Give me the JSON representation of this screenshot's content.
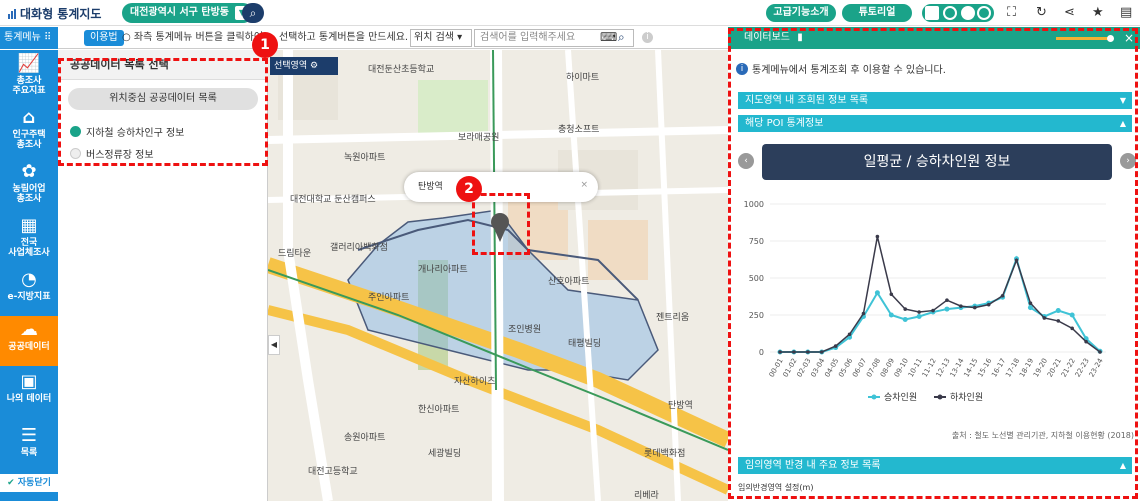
{
  "topbar": {
    "title": "대화형 통계지도",
    "region": "대전광역시 서구 탄방동",
    "advanced_label": "고급기능소개",
    "tutorial_label": "튜토리얼"
  },
  "controls": {
    "menu_label": "통계메뉴",
    "usage_label": "이용법",
    "guide_text": "좌측 통계메뉴 버튼을 클릭하여 ... 선택하고 통계버튼을 만드세요.",
    "location_select": "위치 검색",
    "address_placeholder": "검색어를 입력해주세요"
  },
  "sidebar": {
    "items": [
      {
        "label1": "총조사",
        "label2": "주요지표",
        "icon": "chart-icon"
      },
      {
        "label1": "인구주택",
        "label2": "총조사",
        "icon": "house-icon"
      },
      {
        "label1": "농림어업",
        "label2": "총조사",
        "icon": "wheat-icon"
      },
      {
        "label1": "전국",
        "label2": "사업체조사",
        "icon": "building-icon"
      },
      {
        "label1": "e-지방지표",
        "label2": "",
        "icon": "pie-icon"
      },
      {
        "label1": "공공데이터",
        "label2": "",
        "icon": "cloud-icon",
        "active": true
      },
      {
        "label1": "나의 데이터",
        "label2": "",
        "icon": "user-doc-icon"
      },
      {
        "label1": "목록",
        "label2": "",
        "icon": "menu-icon"
      },
      {
        "label1": "자동닫기",
        "label2": "",
        "icon": "check-icon"
      }
    ]
  },
  "list_panel": {
    "title": "공공데이터 목록 선택",
    "category": "위치중심 공공데이터 목록",
    "items": [
      {
        "label": "지하철 승하차인구 정보",
        "checked": true
      },
      {
        "label": "버스정류장 정보",
        "checked": false
      }
    ]
  },
  "map": {
    "select_area_label": "선택영역",
    "popup_label": "탄방역",
    "labels": [
      "대전둔산초등학교",
      "하이마트",
      "보라매공원",
      "충청소프트",
      "녹원아파트",
      "대전대학교 둔산캠퍼스",
      "갤러리아백화점",
      "개나리아파트",
      "드림타운",
      "주인아파트",
      "산호아파트",
      "조인병원",
      "태평빌딩",
      "젠트리움",
      "자산하이츠",
      "탄방역",
      "한신아파트",
      "송원아파트",
      "세광빌딩",
      "대전고등학교",
      "롯데백화점",
      "리베라"
    ]
  },
  "dashboard": {
    "title": "데이터보드",
    "notice": "통계메뉴에서 통계조회 후 이용할 수 있습니다.",
    "section1": "지도영역 내 조회된 정보 목록",
    "section2": "해당 POI 통계정보",
    "chart_title": "일평균 / 승하차인원 정보",
    "source": "출처 : 철도 노선별 관리기관, 지하철 이용현황 (2018)",
    "section3": "임의영역 반경 내 주요 정보 목록",
    "footer": "임의반경영역 설정(m)"
  },
  "chart_data": {
    "type": "line",
    "title": "일평균 / 승하차인원 정보",
    "categories": [
      "00-01",
      "01-02",
      "02-03",
      "03-04",
      "04-05",
      "05-06",
      "06-07",
      "07-08",
      "08-09",
      "09-10",
      "10-11",
      "11-12",
      "12-13",
      "13-14",
      "14-15",
      "15-16",
      "16-17",
      "17-18",
      "18-19",
      "19-20",
      "20-21",
      "21-22",
      "22-23",
      "23-24"
    ],
    "ylim": [
      0,
      1000
    ],
    "yticks": [
      0,
      250,
      500,
      750,
      1000
    ],
    "series": [
      {
        "name": "승차인원",
        "color": "#3fc3d6",
        "values": [
          0,
          0,
          0,
          0,
          30,
          100,
          240,
          400,
          250,
          220,
          240,
          270,
          290,
          300,
          310,
          330,
          370,
          630,
          300,
          240,
          280,
          250,
          90,
          5
        ]
      },
      {
        "name": "하차인원",
        "color": "#3a3a4a",
        "values": [
          0,
          0,
          0,
          0,
          40,
          120,
          260,
          780,
          390,
          290,
          270,
          280,
          350,
          310,
          300,
          320,
          380,
          620,
          330,
          230,
          210,
          160,
          70,
          0
        ]
      }
    ]
  }
}
